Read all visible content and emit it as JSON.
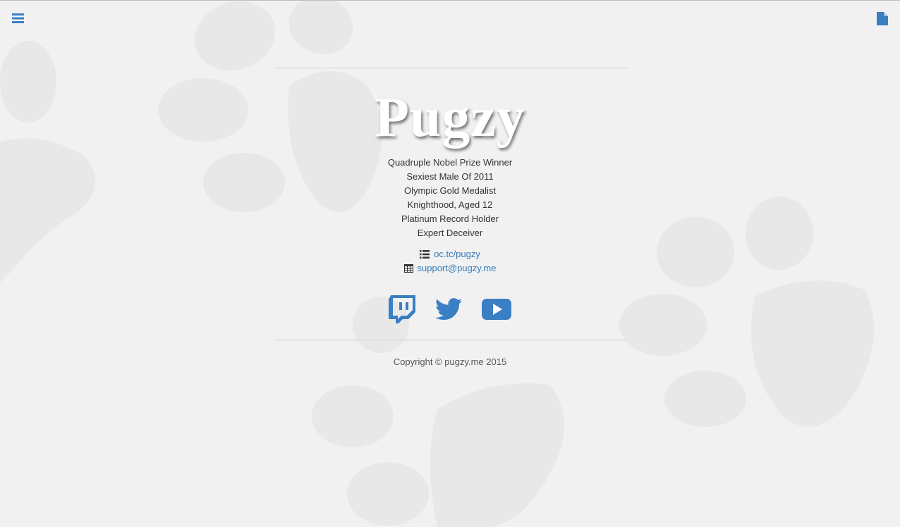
{
  "page": {
    "title": "Pugzy",
    "accent_color": "#3a7fc4"
  },
  "header": {
    "menu_icon": "bars-icon",
    "document_icon": "file-icon"
  },
  "credits": [
    "Quadruple Nobel Prize Winner",
    "Sexiest Male Of 2011",
    "Olympic Gold Medalist",
    "Knighthood, Aged 12",
    "Platinum Record Holder",
    "Expert Deceiver"
  ],
  "contacts": [
    {
      "icon": "list-icon",
      "text": "oc.tc/pugzy"
    },
    {
      "icon": "table-icon",
      "text": "support@pugzy.me"
    }
  ],
  "social": [
    {
      "icon": "twitch-icon"
    },
    {
      "icon": "twitter-icon"
    },
    {
      "icon": "youtube-icon"
    }
  ],
  "footer": {
    "copyright": "Copyright © pugzy.me 2015"
  }
}
